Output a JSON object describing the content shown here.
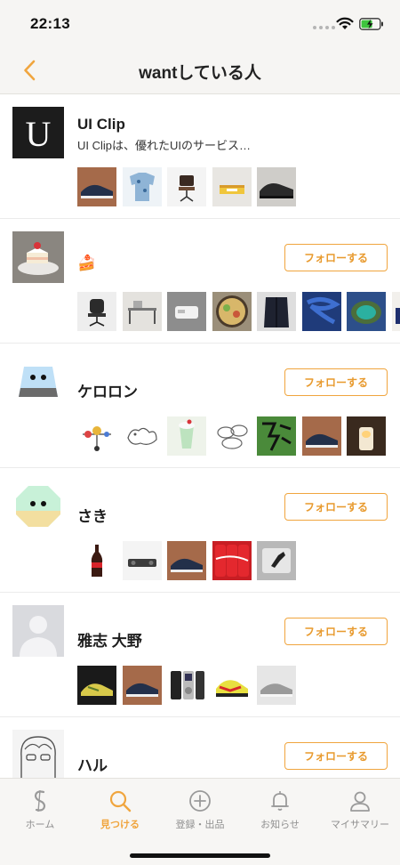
{
  "status_bar": {
    "time": "22:13"
  },
  "nav": {
    "title": "wantしている人",
    "back_icon": "chevron-left-icon"
  },
  "accent_color": "#f0a53e",
  "users": [
    {
      "name": "UI Clip",
      "bio": "UI Clipは、優れたUIのサービス…",
      "follow_label": "",
      "avatar": "letter-u-avatar",
      "thumbs": [
        "navy-sneakers",
        "printed-shirt",
        "office-chair",
        "cake-box",
        "black-sneakers"
      ]
    },
    {
      "name": "🍰",
      "bio": "",
      "follow_label": "フォローする",
      "avatar": "shortcake-photo",
      "thumbs": [
        "mesh-office-chair",
        "standing-desk",
        "white-device",
        "ramen-bowl",
        "dark-coat",
        "blue-rope",
        "lagoon-aerial",
        "matchbox-set"
      ]
    },
    {
      "name": "ケロロン",
      "bio": "",
      "follow_label": "フォローする",
      "avatar": "blue-frog-avatar",
      "thumbs": [
        "planet-mobile",
        "cat-sketch",
        "cream-soda",
        "cloud-sketch",
        "green-book",
        "navy-sneakers",
        "candle-lamp"
      ]
    },
    {
      "name": "さき",
      "bio": "",
      "follow_label": "フォローする",
      "avatar": "green-frog-avatar",
      "thumbs": [
        "cola-bottle",
        "dark-speaker",
        "navy-sneakers",
        "red-cola-cans",
        "laptop-sticker"
      ]
    },
    {
      "name": "雅志 大野",
      "bio": "",
      "follow_label": "フォローする",
      "avatar": "default-person-avatar",
      "thumbs": [
        "yellow-sneaker",
        "navy-sneakers",
        "ipod",
        "neon-sneakers",
        "grey-sneakers"
      ]
    },
    {
      "name": "ハル",
      "bio": "",
      "follow_label": "フォローする",
      "avatar": "anime-sketch-avatar",
      "thumbs": []
    }
  ],
  "tabs": [
    {
      "label": "ホーム",
      "icon": "home-s-logo-icon",
      "active": false
    },
    {
      "label": "見つける",
      "icon": "search-icon",
      "active": true
    },
    {
      "label": "登録・出品",
      "icon": "plus-circle-icon",
      "active": false
    },
    {
      "label": "お知らせ",
      "icon": "bell-icon",
      "active": false
    },
    {
      "label": "マイサマリー",
      "icon": "person-icon",
      "active": false
    }
  ]
}
